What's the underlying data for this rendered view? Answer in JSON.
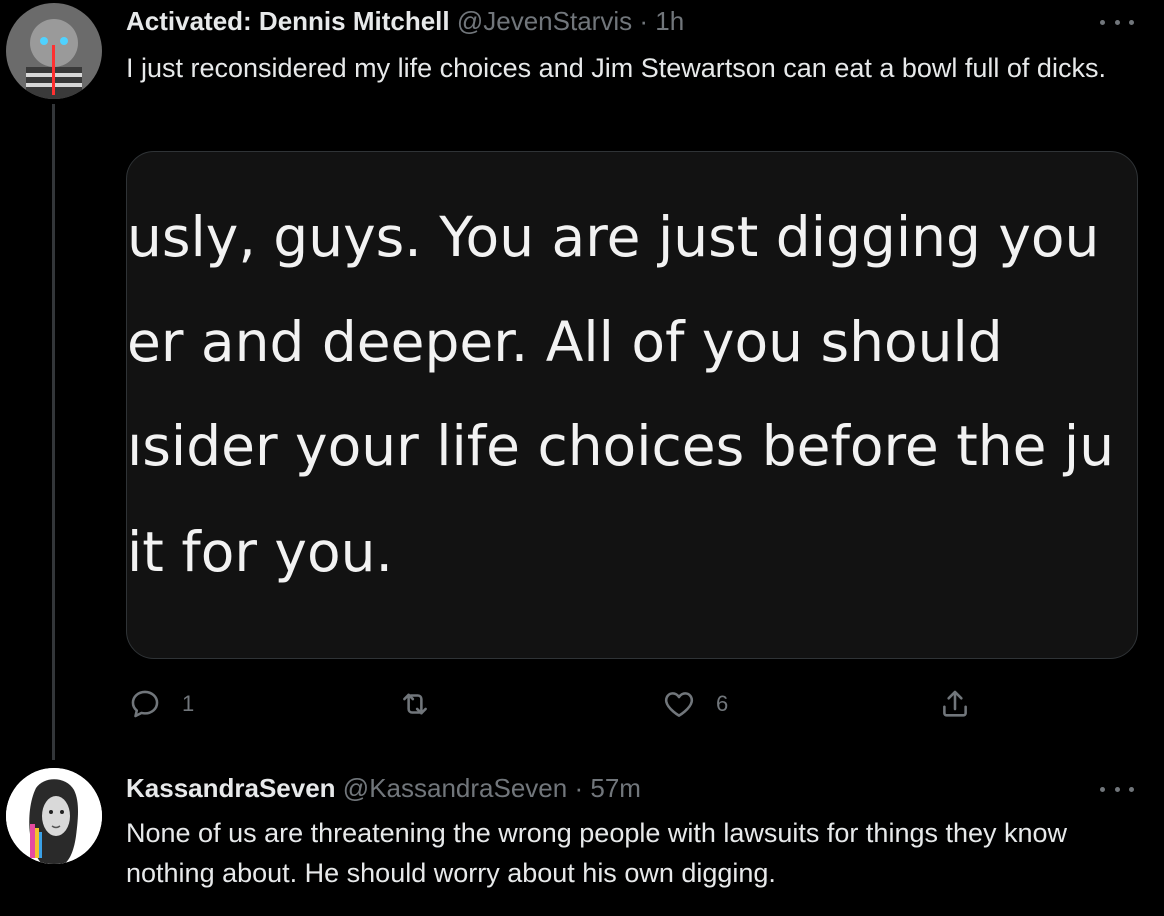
{
  "tweets": [
    {
      "display_name": "Activated: Dennis Mitchell",
      "handle": "@JevenStarvis",
      "dot": "·",
      "time": "1h",
      "text": "I just reconsidered my life choices and Jim Stewartson can eat a bowl full of dicks.",
      "media_lines": [
        "usly, guys. You are just digging you",
        "er and deeper. All of you should",
        "ısider your life choices before the ju",
        " it for you."
      ],
      "actions": {
        "reply_count": "1",
        "retweet_count": "",
        "like_count": "6"
      }
    },
    {
      "display_name": "KassandraSeven",
      "handle": "@KassandraSeven",
      "dot": "·",
      "time": "57m",
      "text": "None of us are threatening the wrong people with lawsuits for things they know nothing about. He should worry about his own digging."
    }
  ],
  "icons": {
    "reply": "reply-icon",
    "retweet": "retweet-icon",
    "like": "heart-icon",
    "share": "share-icon",
    "more": "more-icon"
  },
  "colors": {
    "background": "#000000",
    "text": "#e7e9ea",
    "muted": "#71767b",
    "border": "#2f3336"
  }
}
